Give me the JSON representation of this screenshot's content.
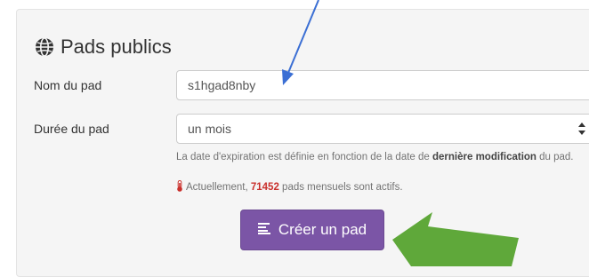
{
  "section": {
    "title": "Pads publics",
    "icon": "globe-icon"
  },
  "form": {
    "pad_name": {
      "label": "Nom du pad",
      "value": "s1hgad8nby"
    },
    "pad_duration": {
      "label": "Durée du pad",
      "selected": "un mois",
      "help_prefix": "La date d'expiration est définie en fonction de la date de ",
      "help_bold": "dernière modification",
      "help_suffix": " du pad."
    }
  },
  "status": {
    "prefix": "Actuellement, ",
    "count": "71452",
    "suffix": " pads mensuels sont actifs.",
    "icon": "thermometer-icon",
    "count_color": "#c9302c"
  },
  "create_button": {
    "label": "Créer un pad",
    "icon": "align-left-icon",
    "color": "#7b55a6"
  },
  "annotations": {
    "blue_arrow_color": "#3b6fd4",
    "green_arrow_color": "#5fa83a"
  }
}
